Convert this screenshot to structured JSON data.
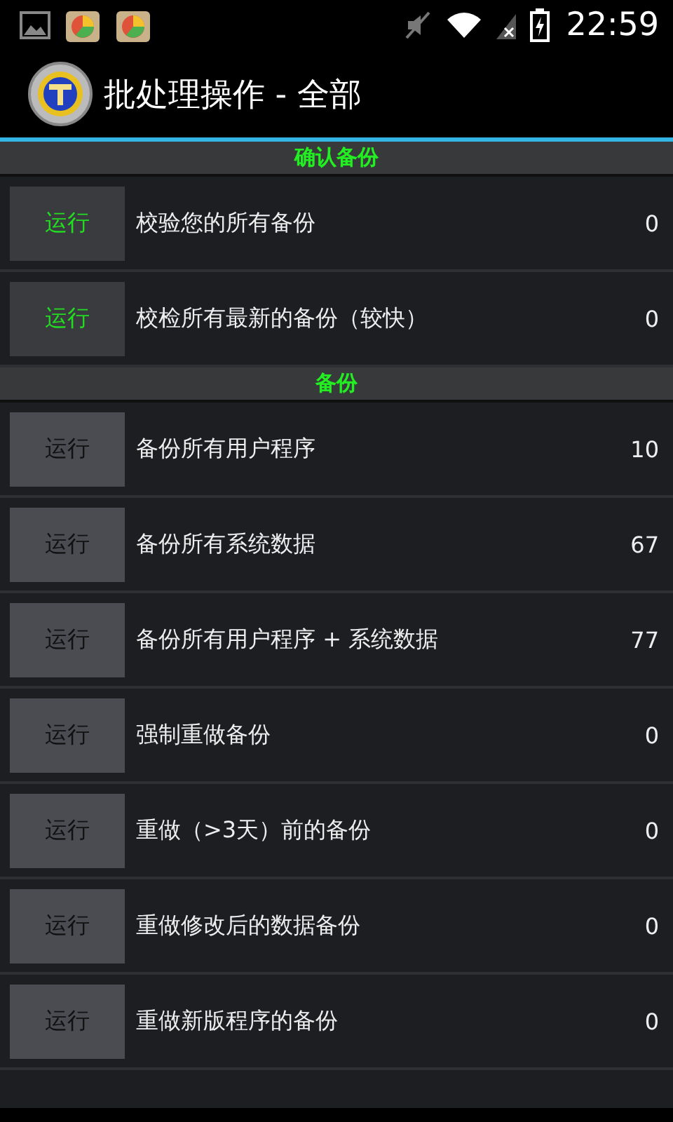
{
  "status_bar": {
    "time": "22:59"
  },
  "action_bar": {
    "title": "批处理操作 - 全部"
  },
  "sections": [
    {
      "title": "确认备份",
      "items": [
        {
          "button": "运行",
          "highlighted": true,
          "label": "校验您的所有备份",
          "count": "0"
        },
        {
          "button": "运行",
          "highlighted": true,
          "label": "校检所有最新的备份（较快）",
          "count": "0"
        }
      ]
    },
    {
      "title": "备份",
      "items": [
        {
          "button": "运行",
          "highlighted": false,
          "label": "备份所有用户程序",
          "count": "10"
        },
        {
          "button": "运行",
          "highlighted": false,
          "label": "备份所有系统数据",
          "count": "67"
        },
        {
          "button": "运行",
          "highlighted": false,
          "label": "备份所有用户程序 + 系统数据",
          "count": "77"
        },
        {
          "button": "运行",
          "highlighted": false,
          "label": "强制重做备份",
          "count": "0"
        },
        {
          "button": "运行",
          "highlighted": false,
          "label": "重做（>3天）前的备份",
          "count": "0"
        },
        {
          "button": "运行",
          "highlighted": false,
          "label": "重做修改后的数据备份",
          "count": "0"
        },
        {
          "button": "运行",
          "highlighted": false,
          "label": "重做新版程序的备份",
          "count": "0"
        }
      ]
    }
  ]
}
